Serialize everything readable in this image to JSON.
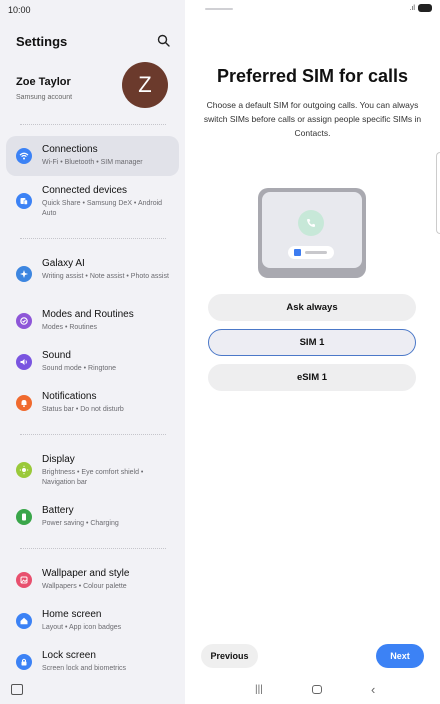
{
  "status": {
    "time": "10:00"
  },
  "sidebar": {
    "title": "Settings",
    "profile": {
      "name": "Zoe Taylor",
      "subtitle": "Samsung account",
      "initial": "Z"
    },
    "items": [
      {
        "title": "Connections",
        "subtitle": "Wi-Fi • Bluetooth • SIM manager",
        "icon": "wifi-icon",
        "color": "#3c82f5"
      },
      {
        "title": "Connected devices",
        "subtitle": "Quick Share • Samsung DeX • Android Auto",
        "icon": "devices-icon",
        "color": "#3c82f5"
      },
      {
        "title": "Galaxy AI",
        "subtitle": "Writing assist • Note assist • Photo assist",
        "icon": "galaxy-ai-icon",
        "color": "#3d86e0"
      },
      {
        "title": "Modes and Routines",
        "subtitle": "Modes • Routines",
        "icon": "modes-icon",
        "color": "#8e56d8"
      },
      {
        "title": "Sound",
        "subtitle": "Sound mode • Ringtone",
        "icon": "sound-icon",
        "color": "#7a55e0"
      },
      {
        "title": "Notifications",
        "subtitle": "Status bar • Do not disturb",
        "icon": "notifications-icon",
        "color": "#f06a2e"
      },
      {
        "title": "Display",
        "subtitle": "Brightness • Eye comfort shield • Navigation bar",
        "icon": "display-icon",
        "color": "#9ac93a"
      },
      {
        "title": "Battery",
        "subtitle": "Power saving • Charging",
        "icon": "battery-icon",
        "color": "#3aa64a"
      },
      {
        "title": "Wallpaper and style",
        "subtitle": "Wallpapers • Colour palette",
        "icon": "wallpaper-icon",
        "color": "#e8506e"
      },
      {
        "title": "Home screen",
        "subtitle": "Layout • App icon badges",
        "icon": "home-icon",
        "color": "#3c82f5"
      },
      {
        "title": "Lock screen",
        "subtitle": "Screen lock and biometrics",
        "icon": "lock-icon",
        "color": "#3c82f5"
      }
    ]
  },
  "main": {
    "title": "Preferred SIM for calls",
    "description": "Choose a default SIM for outgoing calls. You can always switch SIMs before calls or assign people specific SIMs in Contacts.",
    "options": [
      "Ask always",
      "SIM 1",
      "eSIM 1"
    ],
    "selected_option": "SIM 1",
    "previous_label": "Previous",
    "next_label": "Next"
  },
  "colors": {
    "accent": "#3c82f5",
    "selected_border": "#4b78c8",
    "avatar": "#6b3a2c"
  }
}
